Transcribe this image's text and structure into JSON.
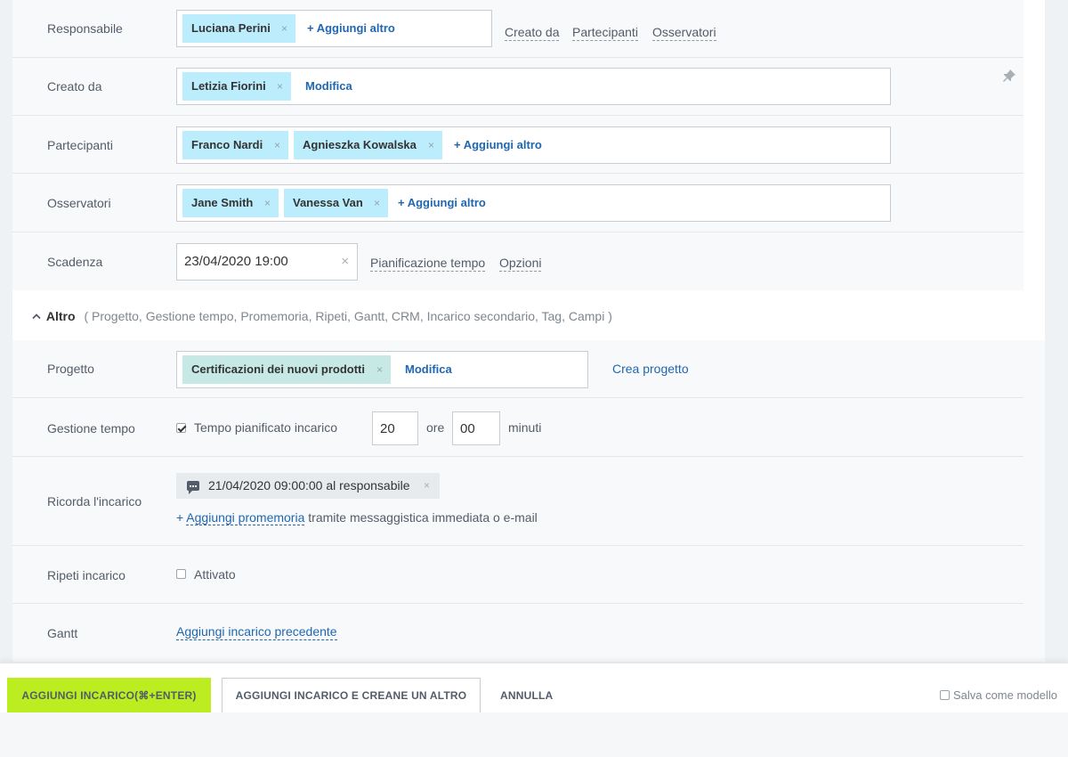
{
  "fields": {
    "responsabile": {
      "label": "Responsabile",
      "tags": [
        "Luciana Perini"
      ],
      "add_label": "+ Aggiungi altro",
      "extra_links": [
        "Creato da",
        "Partecipanti",
        "Osservatori"
      ]
    },
    "creato_da": {
      "label": "Creato da",
      "tags": [
        "Letizia Fiorini"
      ],
      "edit_label": "Modifica"
    },
    "partecipanti": {
      "label": "Partecipanti",
      "tags": [
        "Franco Nardi",
        "Agnieszka Kowalska"
      ],
      "add_label": "+ Aggiungi altro"
    },
    "osservatori": {
      "label": "Osservatori",
      "tags": [
        "Jane Smith",
        "Vanessa Van"
      ],
      "add_label": "+ Aggiungi altro"
    },
    "scadenza": {
      "label": "Scadenza",
      "value": "23/04/2020 19:00",
      "links": [
        "Pianificazione tempo",
        "Opzioni"
      ]
    }
  },
  "more": {
    "title": "Altro",
    "sections": "( Progetto,  Gestione tempo,  Promemoria,  Ripeti,  Gantt,  CRM,  Incarico secondario,  Tag,  Campi )"
  },
  "progetto": {
    "label": "Progetto",
    "tag": "Certificazioni dei nuovi prodotti",
    "edit_label": "Modifica",
    "create_label": "Crea progetto"
  },
  "gestione_tempo": {
    "label": "Gestione tempo",
    "checkbox_label": "Tempo pianificato incarico",
    "checked": true,
    "hours": "20",
    "hours_unit": "ore",
    "minutes": "00",
    "minutes_unit": "minuti"
  },
  "ricorda": {
    "label": "Ricorda l'incarico",
    "reminder": "21/04/2020 09:00:00 al responsabile",
    "add_prefix": "+ ",
    "add_link": "Aggiungi promemoria",
    "add_suffix": " tramite messaggistica immediata o e-mail"
  },
  "ripeti": {
    "label": "Ripeti incarico",
    "checkbox_label": "Attivato",
    "checked": false
  },
  "gantt": {
    "label": "Gantt",
    "link": "Aggiungi incarico precedente"
  },
  "footer": {
    "primary": "AGGIUNGI INCARICO(⌘+ENTER)",
    "secondary": "AGGIUNGI INCARICO E CREANE UN ALTRO",
    "cancel": "ANNULLA",
    "save_template": "Salva come modello"
  },
  "icons": {
    "tag_remove": "×",
    "clear_date": "×",
    "chevron_up": "⌃"
  }
}
